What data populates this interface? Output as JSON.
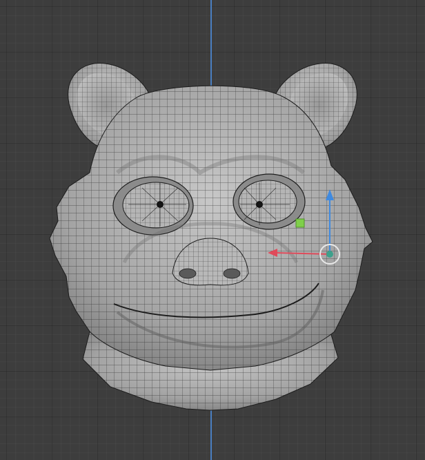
{
  "viewport": {
    "background_color": "#3d3d3d",
    "grid_color": "#333333",
    "z_axis_color": "#4a7fc1"
  },
  "mesh": {
    "object_type": "head-sculpt",
    "shading": "solid",
    "overlay": "wireframe",
    "base_color": "#a9a9a9",
    "wire_color": "#1c1c1c"
  },
  "gizmo": {
    "type": "move",
    "x_axis_color": "#e04a5a",
    "z_axis_color": "#3f8ae0",
    "plane_handle_color": "#7fcf4a",
    "pivot_icon": "3d-cursor-icon"
  }
}
